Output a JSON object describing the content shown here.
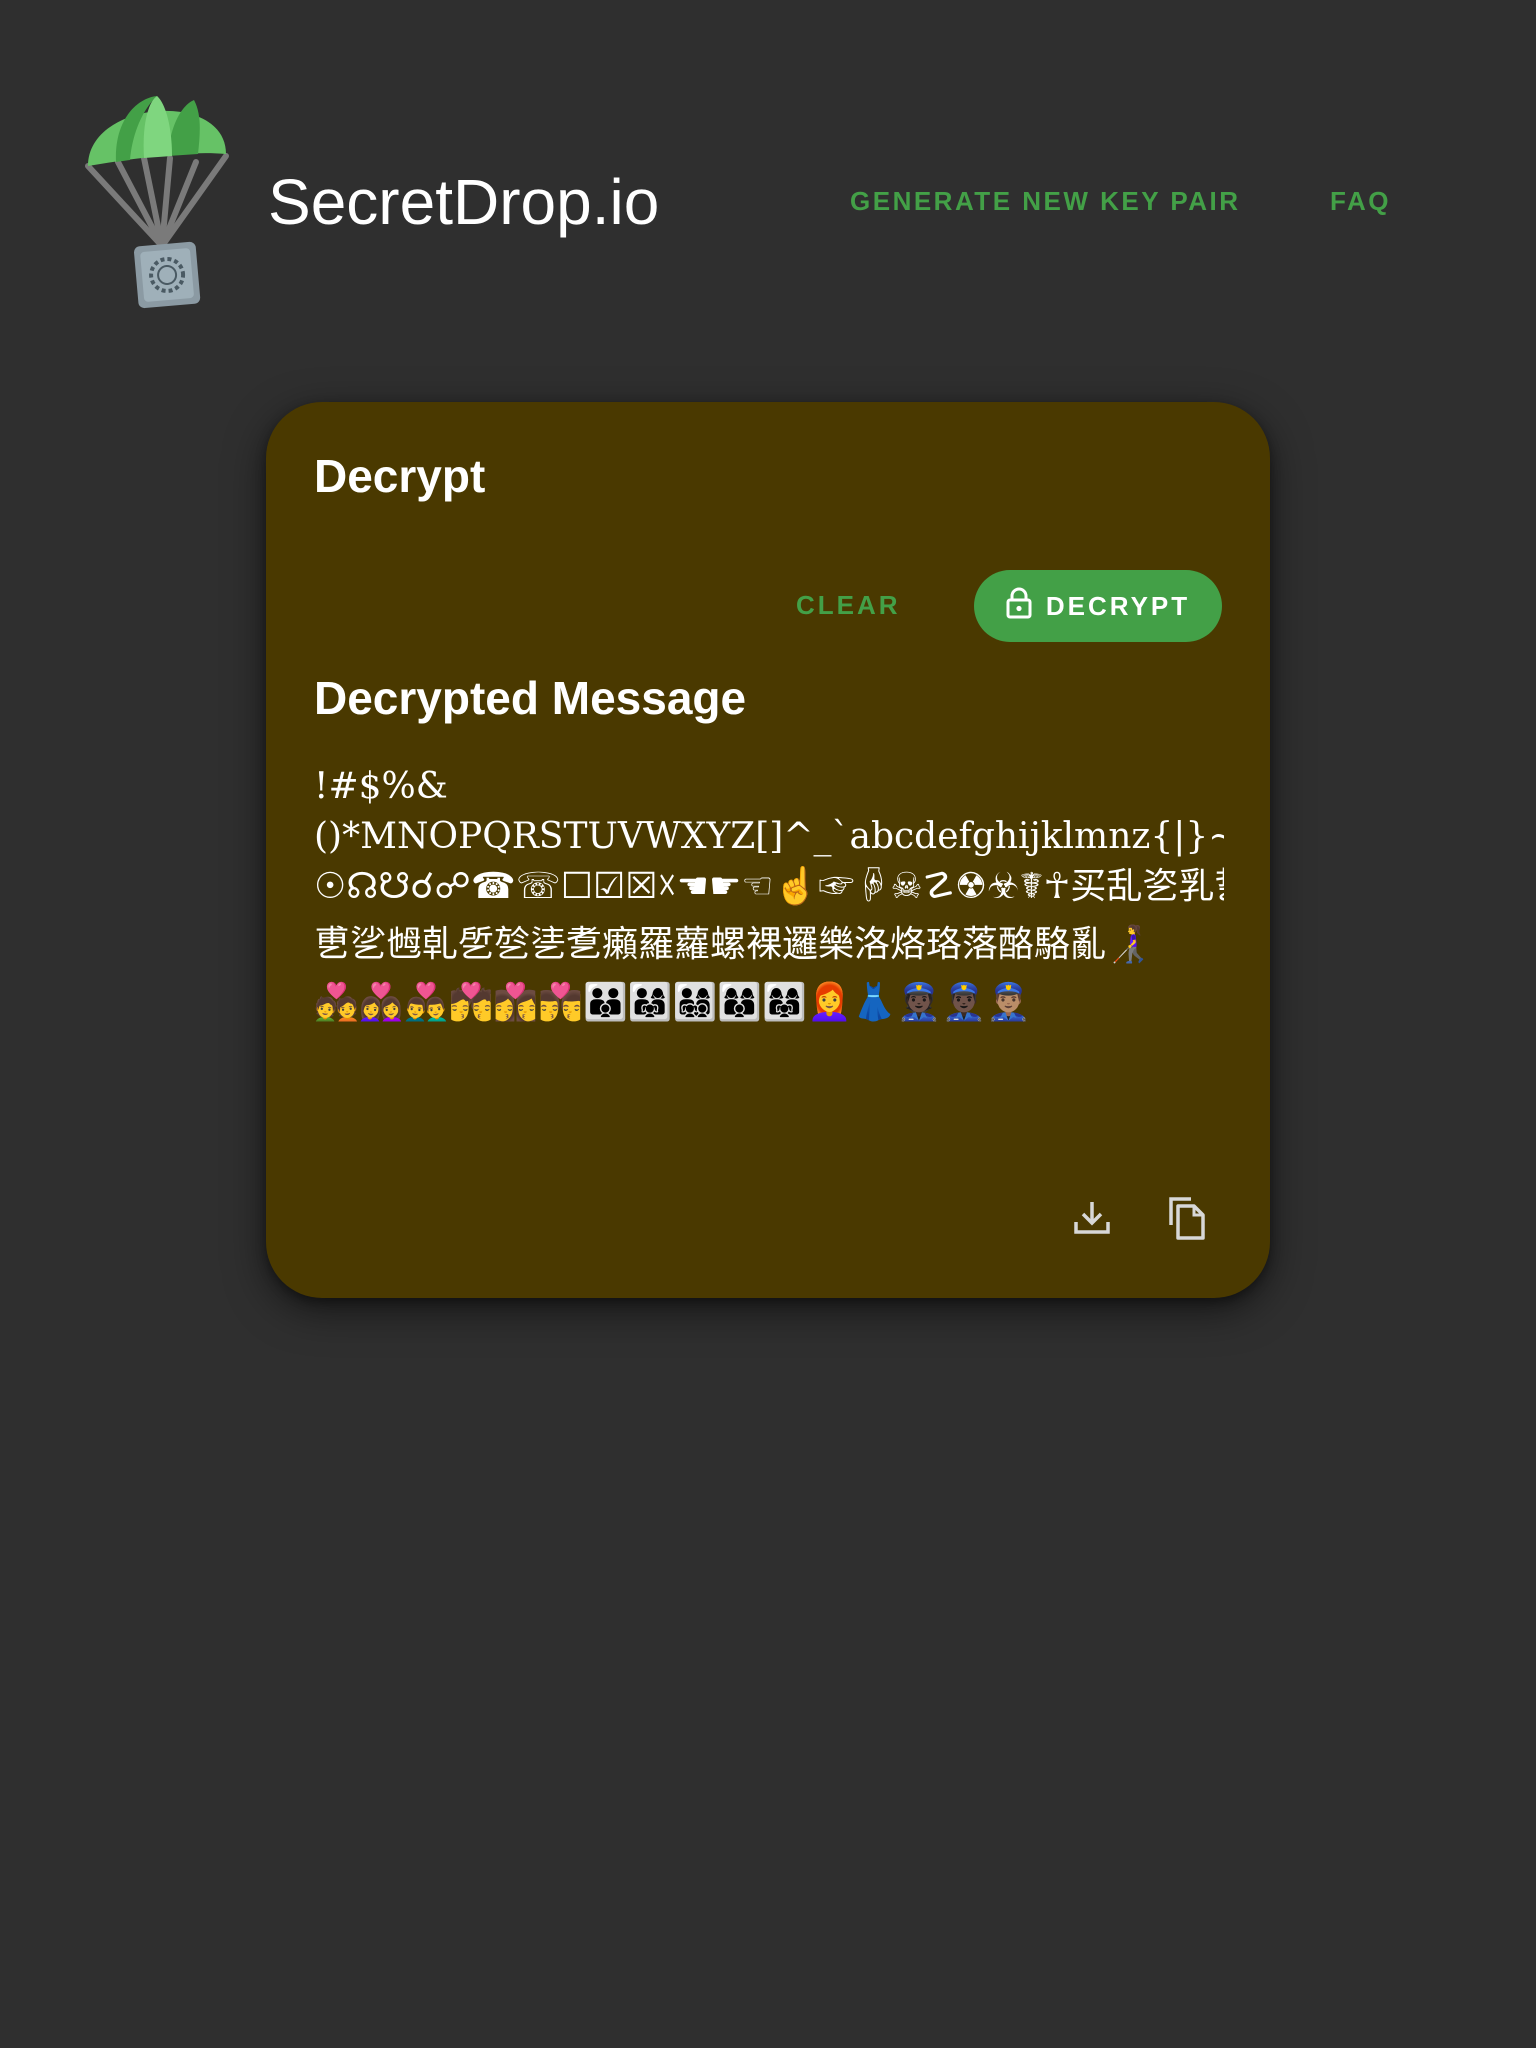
{
  "header": {
    "brand": "SecretDrop.io",
    "logo_icon": "parachute-safe-icon",
    "nav": {
      "generate": "GENERATE NEW KEY PAIR",
      "faq": "FAQ"
    }
  },
  "card": {
    "title": "Decrypt",
    "clear_label": "CLEAR",
    "decrypt_label": "DECRYPT",
    "decrypt_icon": "lock-icon",
    "section_title": "Decrypted Message",
    "message_lines": [
      "!#$%&",
      "()*MNOPQRSTUVWXYZ[]^_`abcdefghijklmnz{|}~ᐸᏒ",
      "☉☊☋☌☍☎☏☐☑☒☓☚☛☜☝☞☟☠☡☢☣☤☥买乱乲乳乴乵",
      "乶乷乸乹乺乻乼乽癩羅蘿螺裸邏樂洛烙珞落酪駱亂👩‍🦯",
      "💑👩‍❤️‍👩👨‍❤️‍👨💏👩‍❤️‍💋‍👩👨‍❤️‍💋‍👨👪👨‍👩‍👧👨‍👩‍👧‍👦👩‍👩‍👦👩‍👩‍👧👩‍🦰👗👮🏿👮🏿‍♂️👮🏽‍♂️"
    ],
    "actions": {
      "download_icon": "download-icon",
      "copy_icon": "copy-icon"
    }
  },
  "colors": {
    "background": "#2f2f2f",
    "card": "#4a3900",
    "accent": "#43a047",
    "text": "#ffffff"
  }
}
